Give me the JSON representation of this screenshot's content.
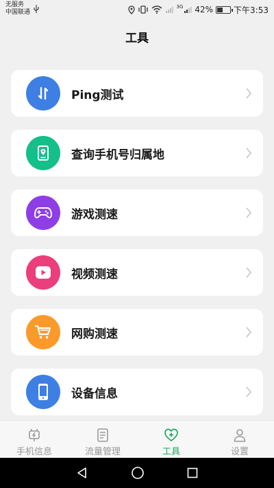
{
  "status_bar": {
    "carrier_line1": "无服务",
    "carrier_line2": "中国联通",
    "battery_percent": "42%",
    "battery_level": 0.42,
    "time": "下午3:53",
    "network_label": "3G"
  },
  "header": {
    "title": "工具"
  },
  "tools": [
    {
      "label": "Ping测试",
      "icon": "ping-arrows-icon",
      "color": "#3d7fe3"
    },
    {
      "label": "查询手机号归属地",
      "icon": "location-card-icon",
      "color": "#14bf8a"
    },
    {
      "label": "游戏测速",
      "icon": "gamepad-icon",
      "color": "#8e3ee6"
    },
    {
      "label": "视频测速",
      "icon": "play-icon",
      "color": "#ea3f7b"
    },
    {
      "label": "网购测速",
      "icon": "shopping-cart-icon",
      "color": "#fb9a2a"
    },
    {
      "label": "设备信息",
      "icon": "phone-device-icon",
      "color": "#3d7fe3"
    }
  ],
  "bottom_nav": [
    {
      "label": "手机信息",
      "icon": "phone-charge-icon",
      "active": false
    },
    {
      "label": "流量管理",
      "icon": "document-icon",
      "active": false
    },
    {
      "label": "工具",
      "icon": "heart-plus-icon",
      "active": true
    },
    {
      "label": "设置",
      "icon": "person-icon",
      "active": false
    }
  ],
  "colors": {
    "accent": "#1fa660",
    "inactive": "#999999",
    "background": "#f0f0f0"
  }
}
